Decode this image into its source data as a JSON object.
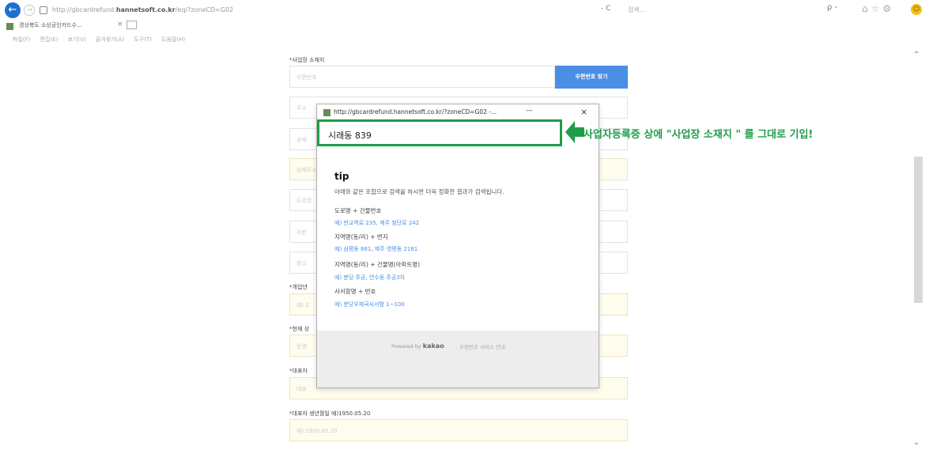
{
  "browser": {
    "url_prefix": "http://gbcardrefund.",
    "url_host": "hannetsoft.co.kr",
    "url_suffix": "/eq/?zoneCD=G02",
    "refresh": "- C",
    "search_placeholder": "검색...",
    "search_tools": "ρ -",
    "toolbar_icons": "⌂☆⚙",
    "tab_label": "경상북도 소상공인카드수...",
    "menu": [
      "파일(F)",
      "편집(E)",
      "보기(V)",
      "즐겨찾기(A)",
      "도구(T)",
      "도움말(H)"
    ]
  },
  "form": {
    "address_label": "*사업장 소재지",
    "zip_placeholder": "우편번호",
    "zip_button": "우편번호 찾기",
    "field_placeholders": [
      "주소",
      "상세",
      "상세주소",
      "도로명",
      "지번",
      "참고"
    ],
    "open_label": "*개업년",
    "open_placeholder": "예) 2",
    "current_label": "*현재 상",
    "current_placeholder": "운영",
    "rep_label": "*대표자",
    "rep_placeholder": "대표",
    "birth_label": "*대표자 생년월일 예)1950.05.20",
    "birth_placeholder": "예) 1950.05.20"
  },
  "popup": {
    "title": "http://gbcardrefund.hannetsoft.co.kr/?zoneCD=G02 -...",
    "search_value": "시래동 839",
    "tip_title": "tip",
    "tip_desc": "아래와 같은 조합으로 검색을 하시면 더욱 정확한 결과가 검색됩니다.",
    "tips": [
      {
        "label": "도로명 + 건물번호",
        "example": "예) 판교역로 235, 제주 첨단로 242"
      },
      {
        "label": "지역명(동/리) + 번지",
        "example": "예) 삼평동 681, 제주 영평동 2181"
      },
      {
        "label": "지역명(동/리) + 건물명(아파트명)",
        "example": "예) 분당 주공, 연수동 주공3차"
      },
      {
        "label": "사서함명 + 번호",
        "example": "예) 분당우체국사서함 1~100"
      }
    ],
    "powered_by": "Powered by",
    "powered_brand": "kakao",
    "footer_link": "우편번호 서비스 안내"
  },
  "annotation": "사업자등록증 상에 \"사업장 소재지 \" 를 그대로 기입!",
  "colors": {
    "accent_green": "#1f9d4a",
    "button_blue": "#4a8ee6"
  }
}
